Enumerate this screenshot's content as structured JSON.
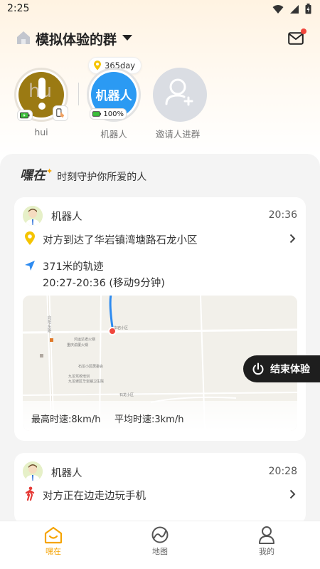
{
  "status": {
    "time": "2:25"
  },
  "header": {
    "group_title": "模拟体验的群"
  },
  "members": [
    {
      "name": "hui",
      "avatar_text": "hu"
    },
    {
      "name": "机器人",
      "avatar_text": "机器人",
      "battery": "100%",
      "days": "365day"
    },
    {
      "name": "邀请人进群"
    }
  ],
  "slogan": {
    "brand": "嘿在",
    "text": "时刻守护你所爱的人"
  },
  "events": [
    {
      "name": "机器人",
      "time": "20:36",
      "location_text": "对方到达了华岩镇湾塘路石龙小区",
      "track_title": "371米的轨迹",
      "track_time": "20:27-20:36 (移动9分钟)",
      "max_speed": "最高时速:8km/h",
      "avg_speed": "平均时速:3km/h",
      "map_labels": [
        "向阳东路",
        "鸿运达老火锅",
        "重庆渝厦火锅",
        "华岩小区",
        "九龙驾校培训",
        "九龙坡区华岩镇卫生院",
        "石龙小区",
        "石龙小区居委会"
      ]
    },
    {
      "name": "机器人",
      "time": "20:28",
      "activity_text": "对方正在边走边玩手机"
    }
  ],
  "end_trial_label": "结束体验",
  "tabs": [
    {
      "label": "嘿在",
      "icon": "home-tab-icon",
      "active": true
    },
    {
      "label": "地图",
      "icon": "map-tab-icon",
      "active": false
    },
    {
      "label": "我的",
      "icon": "profile-tab-icon",
      "active": false
    }
  ],
  "colors": {
    "accent": "#f5a300",
    "blue": "#2b9af3",
    "track": "#2e8bf0",
    "dark_button": "#1e1e1e"
  }
}
